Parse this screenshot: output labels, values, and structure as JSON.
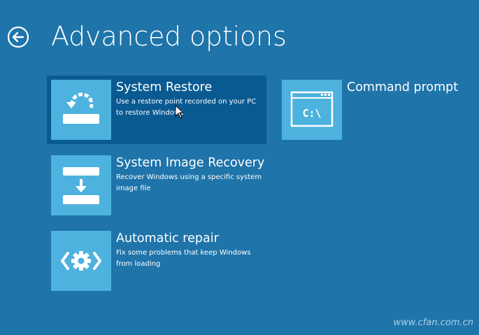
{
  "header": {
    "title": "Advanced options"
  },
  "options": [
    {
      "title": "System Restore",
      "description": "Use a restore point recorded on your PC to restore Windows",
      "icon": "system-restore-icon",
      "selected": true
    },
    {
      "title": "System Image Recovery",
      "description": "Recover Windows using a specific system image file",
      "icon": "system-image-recovery-icon",
      "selected": false
    },
    {
      "title": "Automatic repair",
      "description": "Fix some problems that keep Windows from loading",
      "icon": "automatic-repair-icon",
      "selected": false
    },
    {
      "title": "Command prompt",
      "description": "",
      "icon": "command-prompt-icon",
      "selected": false
    }
  ],
  "command_prompt_icon_text": "C:\\",
  "watermark": "www.cfan.com.cn",
  "colors": {
    "background": "#1f74aa",
    "tile_icon": "#4db2de",
    "selected_tile": "#0a5a92"
  }
}
